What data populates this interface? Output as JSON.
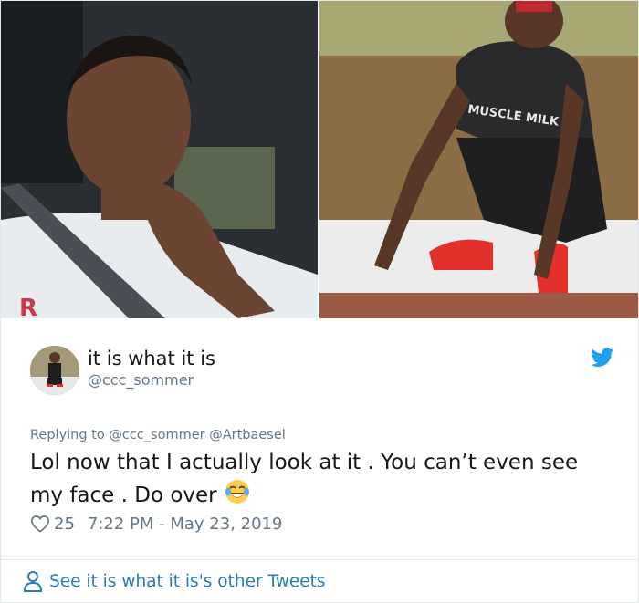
{
  "media": {
    "left_photo": "selfie-photo",
    "right_photo": "crouching-photo",
    "shirt_text": "MUSCLE MILK",
    "shirt_letter": "R"
  },
  "author": {
    "display_name": "it is what it is",
    "handle": "@ccc_sommer"
  },
  "reply": {
    "prefix": "Replying to",
    "mentions": [
      "@ccc_sommer",
      "@Artbaesel"
    ]
  },
  "tweet": {
    "text": "Lol now that I actually look at it . You can’t even see my face . Do over",
    "emoji": "tears-of-joy-emoji"
  },
  "meta": {
    "likes": "25",
    "timestamp": "7:22 PM - May 23, 2019"
  },
  "footer": {
    "other_tweets_label": "See it is what it is's other Tweets"
  },
  "colors": {
    "twitter_blue": "#1da1f2",
    "link_blue": "#2b7bb9",
    "muted": "#657786"
  }
}
